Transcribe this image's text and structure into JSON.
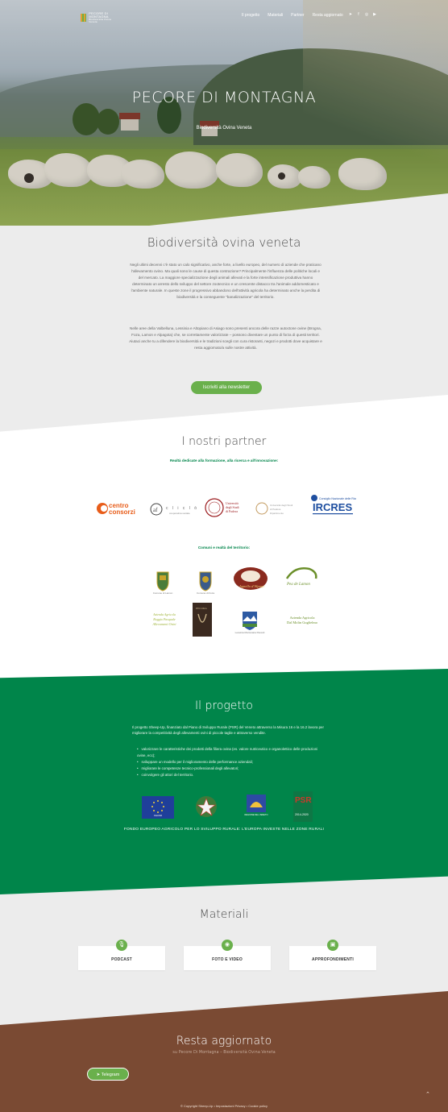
{
  "header": {
    "logo_text": "PECORE DI MONTAGNA",
    "logo_tagline": "Biodiversità Ovina Veneta",
    "nav": [
      "Il progetto",
      "Materiali",
      "Partner",
      "Resta aggiornato"
    ],
    "social": [
      "telegram-icon",
      "facebook-icon",
      "instagram-icon",
      "youtube-icon"
    ]
  },
  "hero": {
    "title": "PECORE DI MONTAGNA",
    "subtitle": "Biodiversità Ovina Veneta"
  },
  "intro": {
    "title": "Biodiversità ovina veneta",
    "p1": "Negli ultimi decenni c'è stato un calo significativo, anche forte, a livello europeo, del numero di aziende che praticano l'allevamento ovino. Ma quali sono le cause di questa contrazione? Principalmente l'influenza delle politiche locali e del mercato. La maggiore specializzazione degli animali allevati e la forte intensificazione produttiva hanno determinato un arresto dello sviluppo del settore zootecnico e un crescente distacco tra l'animale addomesticato e l'ambiente naturale. In queste zone il progressivo abbandono dell'attività agricola ha determinato anche la perdita di biodiversità e la conseguente \"banalizzazione\" del territorio.",
    "p2": "Nelle aree della Valbelluna, Lessinia e Altopiano di Asiago sono presenti ancora delle razze autoctone ovine (Brogna, Foza, Lamon e Alpagota) che, se correttamente valorizzate – possono diventare un punto di forza di questi territori. Aiutaci anche tu a difendere la biodiversità e le tradizioni scegli con cura ristoranti, negozi e prodotti dove acquistare e resta aggiornato/a sulle nostre attività.",
    "button": "Iscriviti alla newsletter"
  },
  "partners": {
    "title": "I nostri partner",
    "subtitle1": "Realtà dedicate alla formazione, alla ricerca e all'innovazione:",
    "logos1": [
      "centro consorzi",
      "cliclò",
      "Università degli Studi di Padova",
      "Università degli Studi di Padova",
      "IRCRES"
    ],
    "subtitle2": "Comuni e realtà del territorio:",
    "logos2": [
      "Comune di Lamon",
      "Comune di Foza",
      "Agnello d'Alpago",
      "Pecora di Lamon",
      "Azienda Agricola Boggio",
      "Pecora Brogna",
      "Lessinia Montanara",
      "Azienda Agricola Dal Molin Guglielmo"
    ]
  },
  "project": {
    "title": "Il progetto",
    "intro": "Il progetto Sheep-Up, finanziato dal Piano di Sviluppo Rurale (PSR) del Veneto attraverso la Misura 16 e la 16.2 lavora per migliorare la competitività degli allevamenti ovini di piccole taglie e attraverso vendite.",
    "items": [
      "valorizzare le caratteristiche dei prodotti della filiera ovina (es. valore nutriceutico e organolettico delle produzioni ovine, ecc);",
      "sviluppare un modello per il miglioramento delle performance aziendali;",
      "migliorare le competenze tecnico-professionali degli allevatori;",
      "coinvolgere gli attori del territorio."
    ],
    "fund_logos": [
      "FEASR",
      "Repubblica Italiana",
      "REGIONE DEL VENETO",
      "PSR Veneto 2014-2020"
    ],
    "fund_text": "FONDO EUROPEO AGRICOLO PER LO SVILUPPO RURALE: L'EUROPA INVESTE NELLE ZONE RURALI"
  },
  "materials": {
    "title": "Materiali",
    "cards": [
      {
        "label": "PODCAST",
        "icon": "microphone-icon"
      },
      {
        "label": "FOTO E VIDEO",
        "icon": "camera-icon"
      },
      {
        "label": "APPROFONDIMENTI",
        "icon": "briefcase-icon"
      }
    ]
  },
  "footer": {
    "title": "Resta aggiornato",
    "subtitle": "su Pecore Di Montagna – Biodiversità Ovina Veneta",
    "telegram_button": "Telegram",
    "copyright": "© Copyright Sheep-Up • Impostazioni Privacy • Cookie policy",
    "accent_green": "#6ab04c",
    "project_green": "#00854a",
    "footer_brown": "#7a4a33"
  }
}
